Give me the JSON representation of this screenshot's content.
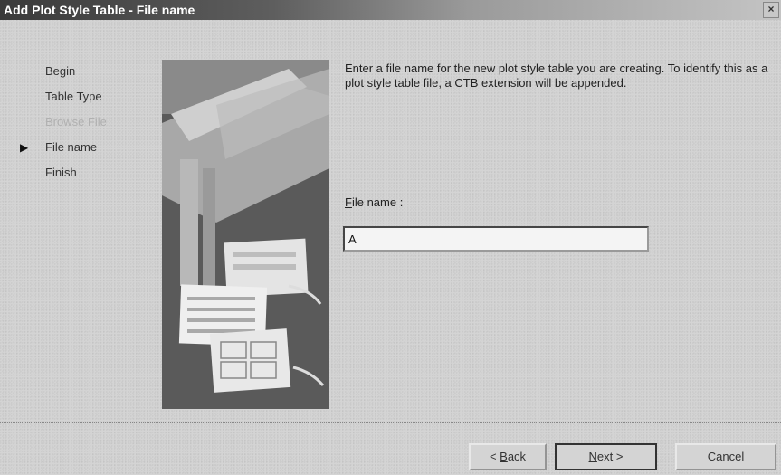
{
  "window": {
    "title": "Add Plot Style Table - File name",
    "close_glyph": "×"
  },
  "steps": [
    {
      "label": "Begin",
      "state": "normal"
    },
    {
      "label": "Table Type",
      "state": "normal"
    },
    {
      "label": "Browse File",
      "state": "disabled"
    },
    {
      "label": "File name",
      "state": "current"
    },
    {
      "label": "Finish",
      "state": "normal"
    }
  ],
  "current_step_marker": "▶",
  "description": "Enter a file name for the new plot style table you are creating. To identify this as a plot style table file, a CTB extension will be appended.",
  "field": {
    "label_mnemonic": "F",
    "label_rest": "ile name :",
    "value": "A"
  },
  "buttons": {
    "back_mnemonic": "B",
    "back_prefix": "< ",
    "back_rest": "ack",
    "next_mnemonic": "N",
    "next_rest": "ext >",
    "cancel": "Cancel"
  },
  "icons": {
    "close": "close-icon",
    "current_step": "arrow-right-icon"
  }
}
